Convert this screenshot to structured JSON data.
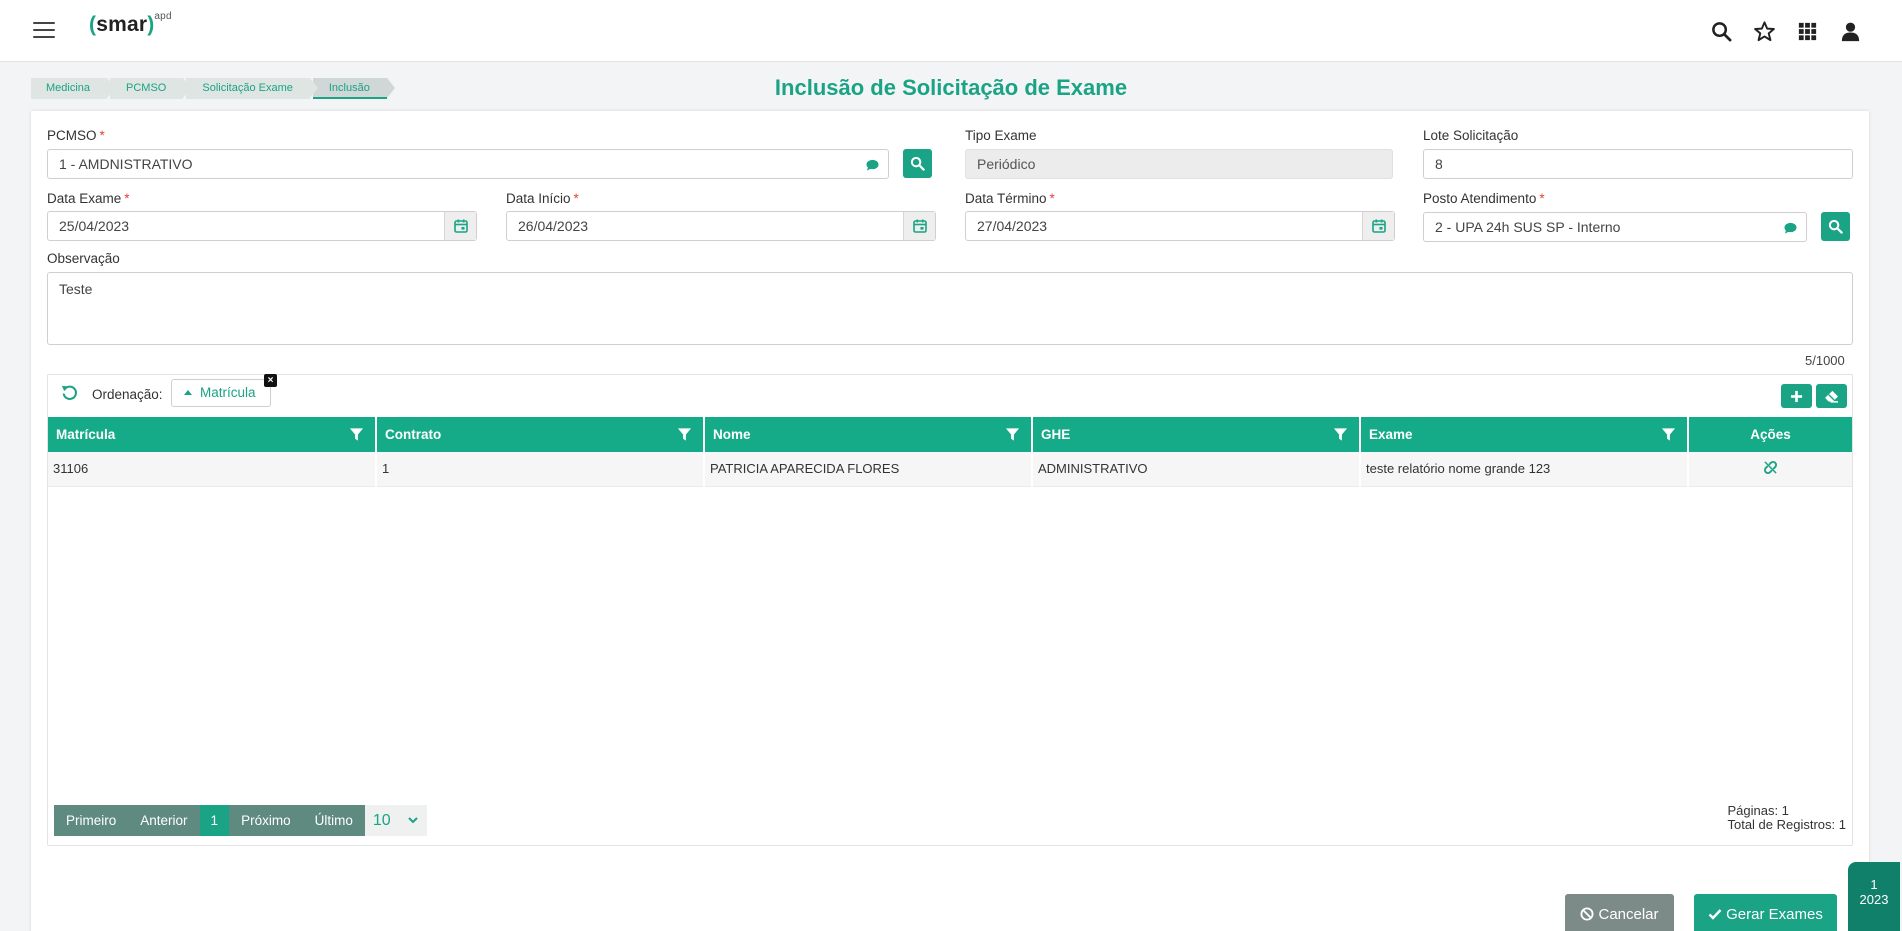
{
  "app": {
    "logo_left": "(",
    "logo_main": "smar",
    "logo_right": ")",
    "logo_sup": "apd"
  },
  "breadcrumb": [
    "Medicina",
    "PCMSO",
    "Solicitação Exame",
    "Inclusão"
  ],
  "page_title": "Inclusão de Solicitação de Exame",
  "form": {
    "pcmso": {
      "label": "PCMSO",
      "required": "*",
      "value": "1 - AMDNISTRATIVO"
    },
    "tipo_exame": {
      "label": "Tipo Exame",
      "value": "Periódico"
    },
    "lote": {
      "label": "Lote Solicitação",
      "value": "8"
    },
    "data_exame": {
      "label": "Data Exame",
      "required": "*",
      "value": "25/04/2023"
    },
    "data_inicio": {
      "label": "Data Início",
      "required": "*",
      "value": "26/04/2023"
    },
    "data_termino": {
      "label": "Data Término",
      "required": "*",
      "value": "27/04/2023"
    },
    "posto": {
      "label": "Posto Atendimento",
      "required": "*",
      "value": "2 - UPA 24h SUS SP - Interno"
    },
    "observacao": {
      "label": "Observação",
      "value": "Teste",
      "char_count": "5/1000"
    }
  },
  "grid": {
    "sort_label": "Ordenação:",
    "sort_chip": "Matrícula",
    "chip_close": "×",
    "columns": [
      "Matrícula",
      "Contrato",
      "Nome",
      "GHE",
      "Exame",
      "Ações"
    ],
    "rows": [
      {
        "matricula": "31106",
        "contrato": "1",
        "nome": "PATRICIA APARECIDA FLORES",
        "ghe": "ADMINISTRATIVO",
        "exame": "teste relatório nome grande 123"
      }
    ],
    "pager": {
      "first": "Primeiro",
      "prev": "Anterior",
      "current": "1",
      "next": "Próximo",
      "last": "Último",
      "page_size": "10"
    },
    "info": {
      "pages": "Páginas: 1",
      "total": "Total de Registros: 1"
    }
  },
  "actions": {
    "cancel": "Cancelar",
    "generate": "Gerar Exames"
  },
  "badge": {
    "line1": "1",
    "line2": "2023"
  },
  "colors": {
    "accent": "#1aa384",
    "header": "#15ab88",
    "pager": "#5f8a7f",
    "cancel": "#7d8b88"
  }
}
